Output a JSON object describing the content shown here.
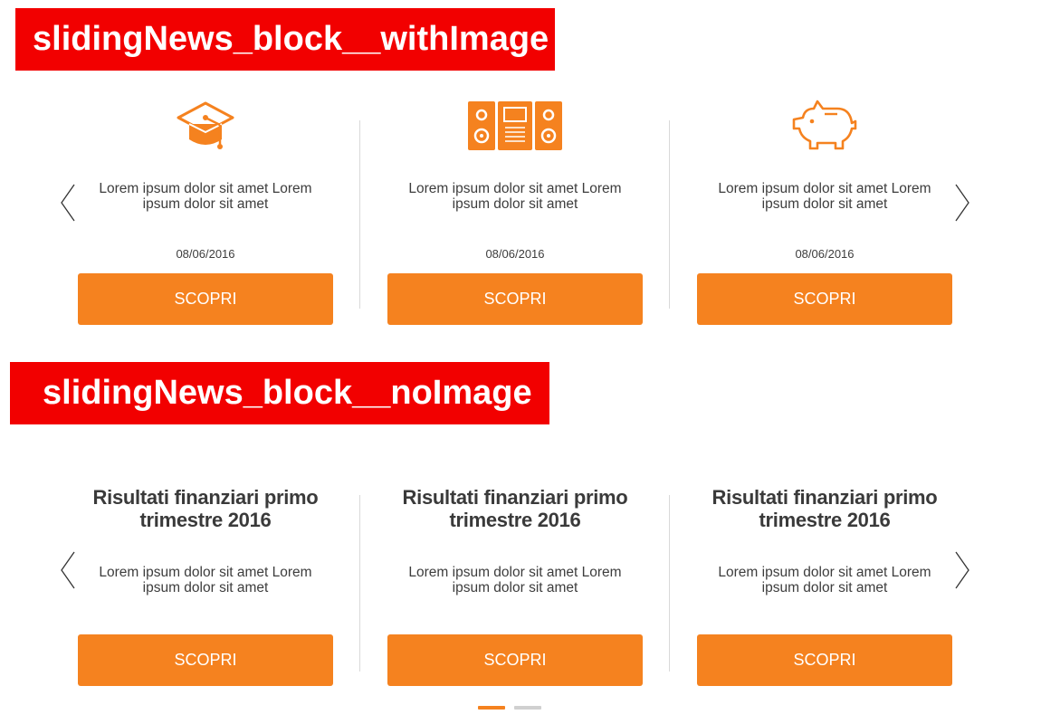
{
  "colors": {
    "accent": "#f5821f",
    "banner": "#f20000",
    "divider": "#d9d9d9"
  },
  "blocks": [
    {
      "label": "slidingNews_block__withImage",
      "cards": [
        {
          "icon": "graduation-cap-icon",
          "text": "Lorem ipsum dolor sit amet Lorem ipsum dolor sit amet",
          "date": "08/06/2016",
          "button": "SCOPRI"
        },
        {
          "icon": "stereo-speakers-icon",
          "text": "Lorem ipsum dolor sit amet Lorem ipsum dolor sit amet",
          "date": "08/06/2016",
          "button": "SCOPRI"
        },
        {
          "icon": "piggy-bank-icon",
          "text": "Lorem ipsum dolor sit amet Lorem ipsum dolor sit amet",
          "date": "08/06/2016",
          "button": "SCOPRI"
        }
      ]
    },
    {
      "label": "slidingNews_block__noImage",
      "cards": [
        {
          "title": "Risultati finanziari primo trimestre 2016",
          "text": "Lorem ipsum dolor sit amet Lorem ipsum dolor sit amet",
          "button": "SCOPRI"
        },
        {
          "title": "Risultati finanziari primo trimestre 2016",
          "text": "Lorem ipsum dolor sit amet Lorem ipsum dolor sit amet",
          "button": "SCOPRI"
        },
        {
          "title": "Risultati finanziari primo trimestre 2016",
          "text": "Lorem ipsum dolor sit amet Lorem ipsum dolor sit amet",
          "button": "SCOPRI"
        }
      ],
      "pagination": {
        "pages": 2,
        "active": 1
      }
    }
  ]
}
